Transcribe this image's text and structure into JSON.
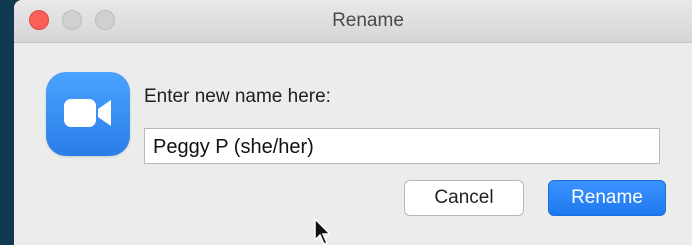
{
  "window": {
    "title": "Rename"
  },
  "app_icon": "zoom-camera-icon",
  "dialog": {
    "prompt": "Enter new name here:",
    "name_input": {
      "value": "Peggy P (she/her)"
    },
    "buttons": {
      "cancel_label": "Cancel",
      "rename_label": "Rename"
    }
  },
  "colors": {
    "accent": "#2a7de8",
    "close_button": "#fc5f57",
    "background": "#0f3a4f"
  }
}
